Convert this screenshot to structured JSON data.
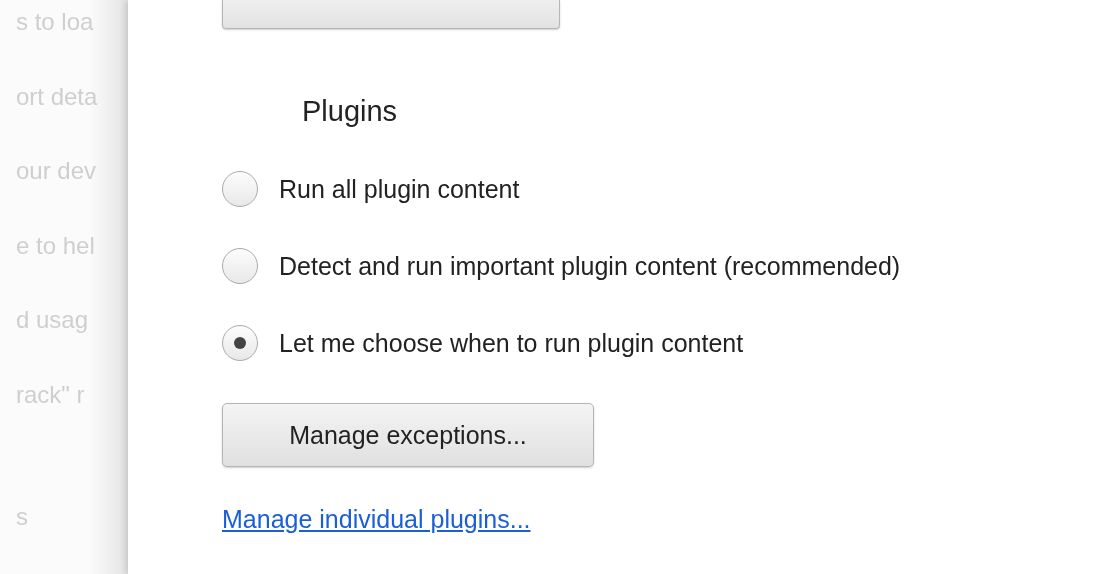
{
  "background_page": {
    "lines": [
      "s to loa",
      "ort deta",
      "our dev",
      "e to hel",
      "d usag",
      "rack\" r",
      "s"
    ]
  },
  "plugins": {
    "title": "Plugins",
    "options": [
      {
        "label": "Run all plugin content",
        "selected": false
      },
      {
        "label": "Detect and run important plugin content (recommended)",
        "selected": false
      },
      {
        "label": "Let me choose when to run plugin content",
        "selected": true
      }
    ],
    "button": "Manage exceptions...",
    "link": "Manage individual plugins..."
  }
}
